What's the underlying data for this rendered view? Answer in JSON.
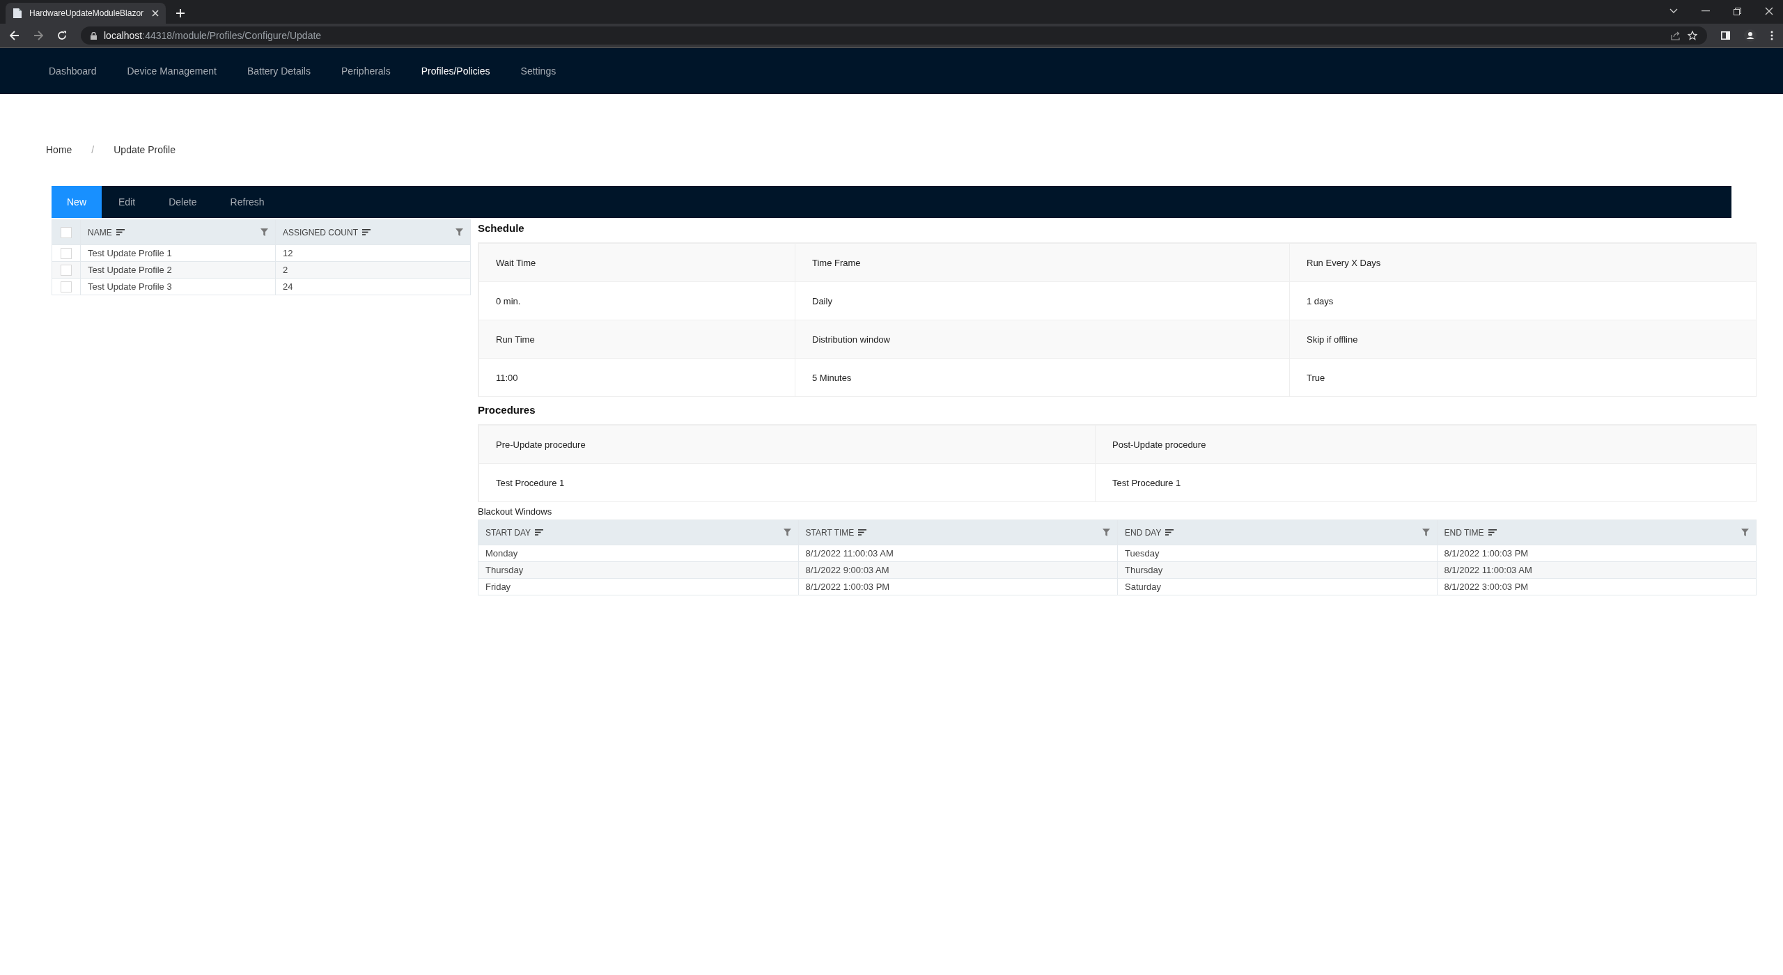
{
  "browser": {
    "tab_title": "HardwareUpdateModuleBlazor",
    "url_host": "localhost",
    "url_rest": ":44318/module/Profiles/Configure/Update"
  },
  "nav": [
    {
      "label": "Dashboard",
      "selected": false
    },
    {
      "label": "Device Management",
      "selected": false
    },
    {
      "label": "Battery Details",
      "selected": false
    },
    {
      "label": "Peripherals",
      "selected": false
    },
    {
      "label": "Profiles/Policies",
      "selected": true
    },
    {
      "label": "Settings",
      "selected": false
    }
  ],
  "breadcrumb": {
    "items": [
      "Home",
      "Update Profile"
    ],
    "separator": "/"
  },
  "toolbar": [
    {
      "label": "New",
      "kind": "primary"
    },
    {
      "label": "Edit",
      "kind": "plain"
    },
    {
      "label": "Delete",
      "kind": "plain"
    },
    {
      "label": "Refresh",
      "kind": "plain"
    }
  ],
  "profiles": {
    "header_checked": false,
    "columns": [
      "NAME",
      "ASSIGNED COUNT"
    ],
    "rows": [
      {
        "checked": false,
        "cells": [
          "Test Update Profile 1",
          "12"
        ]
      },
      {
        "checked": false,
        "cells": [
          "Test Update Profile 2",
          "2"
        ]
      },
      {
        "checked": false,
        "cells": [
          "Test Update Profile 3",
          "24"
        ]
      }
    ]
  },
  "schedule": {
    "title": "Schedule",
    "rows": [
      [
        "Wait Time",
        "Time Frame",
        "Run Every X Days"
      ],
      [
        "0 min.",
        "Daily",
        "1 days"
      ],
      [
        "Run Time",
        "Distribution window",
        "Skip if offline"
      ],
      [
        "11:00",
        "5 Minutes",
        "True"
      ]
    ]
  },
  "procedures": {
    "title": "Procedures",
    "rows": [
      [
        "Pre-Update procedure",
        "Post-Update procedure"
      ],
      [
        "Test Procedure 1",
        "Test Procedure 1"
      ]
    ]
  },
  "blackout": {
    "title": "Blackout Windows",
    "columns": [
      "START DAY",
      "START TIME",
      "END DAY",
      "END TIME"
    ],
    "rows": [
      [
        "Monday",
        "8/1/2022 11:00:03 AM",
        "Tuesday",
        "8/1/2022 1:00:03 PM"
      ],
      [
        "Thursday",
        "8/1/2022 9:00:03 AM",
        "Thursday",
        "8/1/2022 11:00:03 AM"
      ],
      [
        "Friday",
        "8/1/2022 1:00:03 PM",
        "Saturday",
        "8/1/2022 3:00:03 PM"
      ]
    ]
  }
}
